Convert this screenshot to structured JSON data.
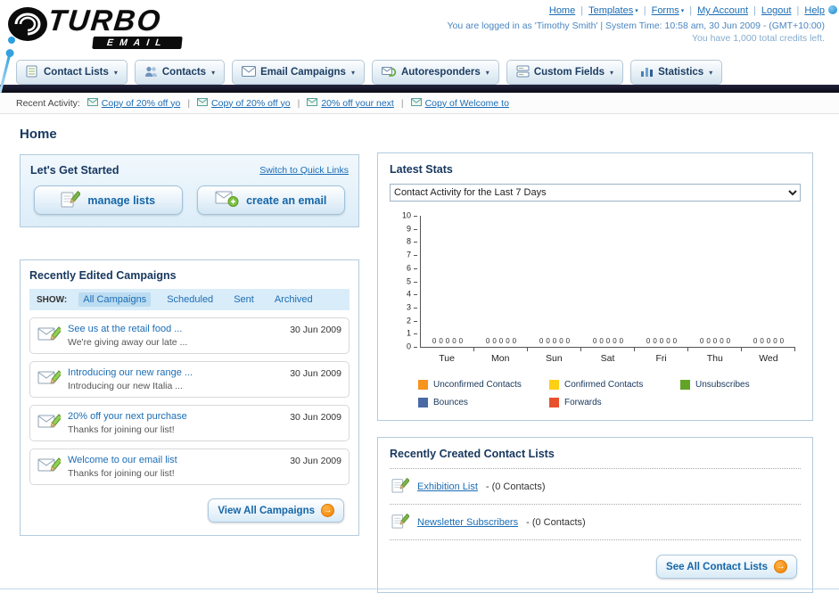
{
  "page": {
    "title": "Home"
  },
  "header": {
    "logo": {
      "word": "TURBO",
      "sub": "EMAIL"
    },
    "nav": {
      "items": [
        {
          "label": "Home"
        },
        {
          "label": "Templates"
        },
        {
          "label": "Forms"
        },
        {
          "label": "My Account"
        },
        {
          "label": "Logout"
        },
        {
          "label": "Help"
        }
      ]
    },
    "login_info": "You are logged in as 'Timothy Smith' | System Time: 10:58 am, 30 Jun 2009 - (GMT+10:00)",
    "credits_info": "You have 1,000 total credits left."
  },
  "main_nav": {
    "tabs": [
      {
        "label": "Contact Lists"
      },
      {
        "label": "Contacts"
      },
      {
        "label": "Email Campaigns"
      },
      {
        "label": "Autoresponders"
      },
      {
        "label": "Custom Fields"
      },
      {
        "label": "Statistics"
      }
    ]
  },
  "recent_activity": {
    "label": "Recent Activity:",
    "items": [
      {
        "text": "Copy of 20% off yo"
      },
      {
        "text": "Copy of 20% off yo"
      },
      {
        "text": "20% off your next"
      },
      {
        "text": "Copy of Welcome to"
      }
    ]
  },
  "get_started": {
    "title": "Let's Get Started",
    "switch_link": "Switch to Quick Links",
    "manage_lists_label": "manage lists",
    "create_email_label": "create an email"
  },
  "campaigns": {
    "title": "Recently Edited Campaigns",
    "show_label": "SHOW:",
    "tabs": [
      {
        "label": "All Campaigns",
        "active": true
      },
      {
        "label": "Scheduled",
        "active": false
      },
      {
        "label": "Sent",
        "active": false
      },
      {
        "label": "Archived",
        "active": false
      }
    ],
    "items": [
      {
        "title": "See us at the retail food ...",
        "subtitle": "We're giving away our late ...",
        "date": "30 Jun 2009"
      },
      {
        "title": "Introducing our new range ...",
        "subtitle": "Introducing our new Italia ...",
        "date": "30 Jun 2009"
      },
      {
        "title": "20% off your next purchase",
        "subtitle": "Thanks for joining our list!",
        "date": "30 Jun 2009"
      },
      {
        "title": "Welcome to our email list",
        "subtitle": "Thanks for joining our list!",
        "date": "30 Jun 2009"
      }
    ],
    "view_all_label": "View All Campaigns"
  },
  "latest_stats": {
    "title": "Latest Stats",
    "dropdown_value": "Contact Activity for the Last 7 Days",
    "chart_data": {
      "type": "bar",
      "categories": [
        "Tue",
        "Mon",
        "Sun",
        "Sat",
        "Fri",
        "Thu",
        "Wed"
      ],
      "series": [
        {
          "name": "Unconfirmed Contacts",
          "color": "#f7941d",
          "values": [
            0,
            0,
            0,
            0,
            0,
            0,
            0
          ]
        },
        {
          "name": "Confirmed Contacts",
          "color": "#fdd016",
          "values": [
            0,
            0,
            0,
            0,
            0,
            0,
            0
          ]
        },
        {
          "name": "Unsubscribes",
          "color": "#61a427",
          "values": [
            0,
            0,
            0,
            0,
            0,
            0,
            0
          ]
        },
        {
          "name": "Bounces",
          "color": "#4a69a5",
          "values": [
            0,
            0,
            0,
            0,
            0,
            0,
            0
          ]
        },
        {
          "name": "Forwards",
          "color": "#e8502d",
          "values": [
            0,
            0,
            0,
            0,
            0,
            0,
            0
          ]
        }
      ],
      "ylim": [
        0,
        10
      ],
      "yticks": [
        0,
        1,
        2,
        3,
        4,
        5,
        6,
        7,
        8,
        9,
        10
      ],
      "grid": false,
      "legend_position": "bottom"
    }
  },
  "contact_lists": {
    "title": "Recently Created Contact Lists",
    "items": [
      {
        "name": "Exhibition List",
        "detail": "- (0 Contacts)"
      },
      {
        "name": "Newsletter Subscribers",
        "detail": "- (0 Contacts)"
      }
    ],
    "see_all_label": "See All Contact Lists"
  },
  "colors": {
    "link_blue": "#1b6db5",
    "navy_title": "#17375e",
    "accent_orange": "#f7941d",
    "nav_strip": "#0e0e1c"
  }
}
